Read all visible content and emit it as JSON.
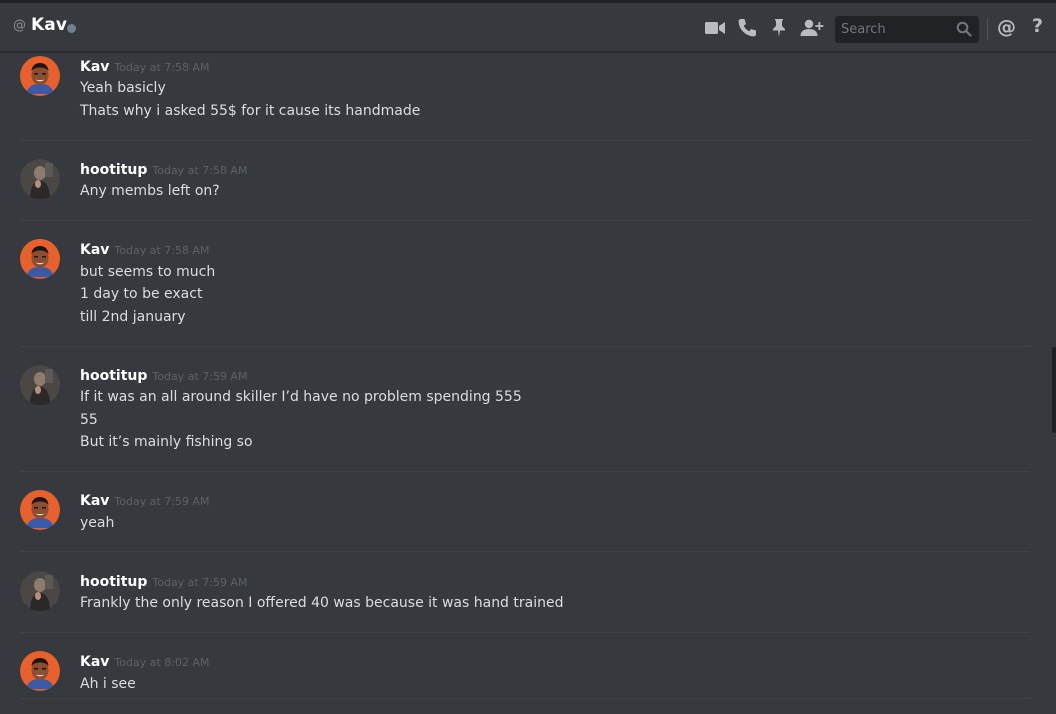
{
  "header": {
    "at_symbol": "@",
    "title": "Kav",
    "search_placeholder": "Search",
    "mention_symbol": "@",
    "help_symbol": "?"
  },
  "messages": [
    {
      "username": "Kav",
      "timestamp": "Today at 7:58 AM",
      "lines": [
        "Yeah basicly",
        "Thats why i asked 55$ for it cause its handmade"
      ]
    },
    {
      "username": "hootitup",
      "timestamp": "Today at 7:58 AM",
      "lines": [
        "Any membs left on?"
      ]
    },
    {
      "username": "Kav",
      "timestamp": "Today at 7:58 AM",
      "lines": [
        "but seems to much",
        "1 day to be exact",
        "till 2nd january"
      ]
    },
    {
      "username": "hootitup",
      "timestamp": "Today at 7:59 AM",
      "lines": [
        "If it was an all around skiller I’d have no problem spending 555",
        "55",
        "But it’s mainly fishing so"
      ]
    },
    {
      "username": "Kav",
      "timestamp": "Today at 7:59 AM",
      "lines": [
        "yeah"
      ]
    },
    {
      "username": "hootitup",
      "timestamp": "Today at 7:59 AM",
      "lines": [
        "Frankly the only reason I offered 40 was because it was hand trained"
      ]
    },
    {
      "username": "Kav",
      "timestamp": "Today at 8:02 AM",
      "lines": [
        "Ah i see"
      ]
    }
  ],
  "colors": {
    "background": "#36393e",
    "username": "#ffffff",
    "message_text": "#dcddde",
    "timestamp": "#5d6167",
    "status_offline": "#747f8d"
  },
  "icons": [
    "video-call-icon",
    "voice-call-icon",
    "pin-icon",
    "add-friend-icon",
    "search-icon",
    "mention-icon",
    "help-icon"
  ]
}
